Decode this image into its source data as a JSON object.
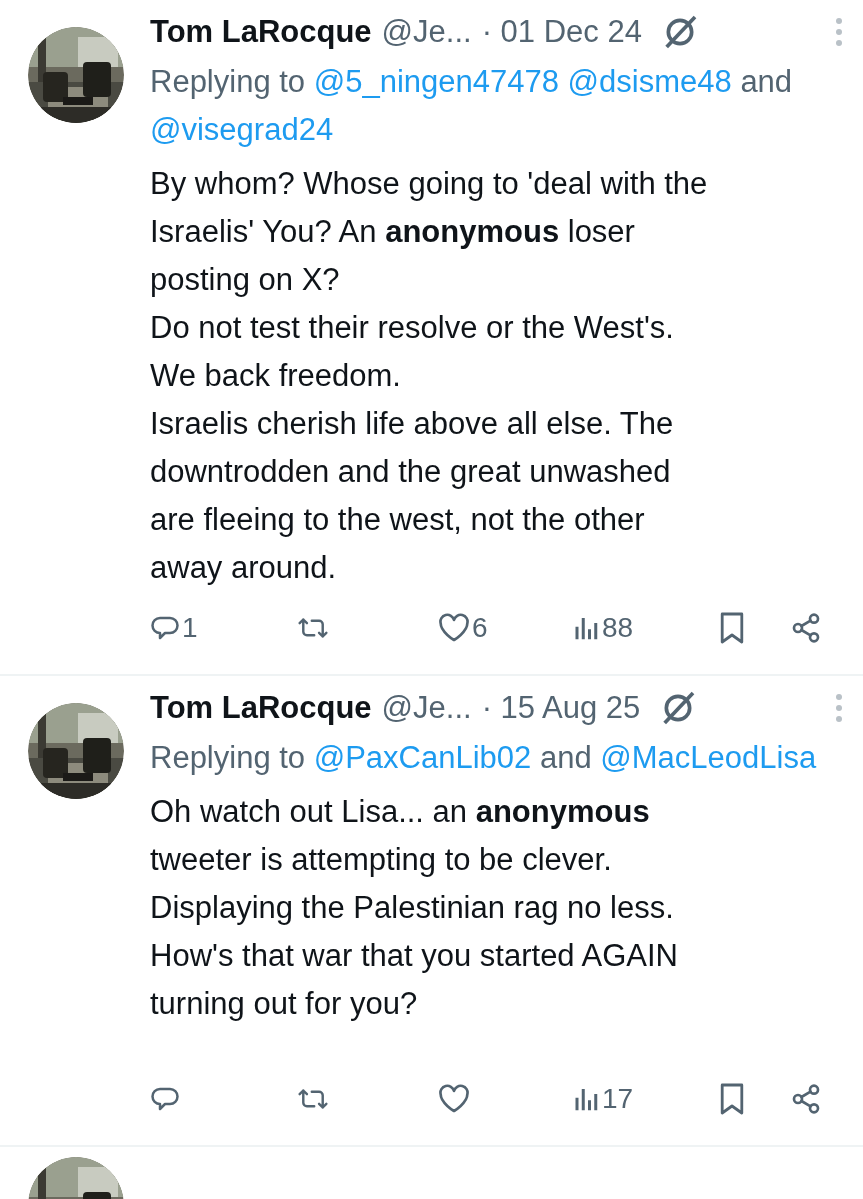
{
  "tweets": [
    {
      "name": "Tom LaRocque",
      "handle": "@Je...",
      "date": "· 01 Dec 24",
      "replying_to": [
        {
          "kind": "plain",
          "text": "Replying to"
        },
        {
          "kind": "mention",
          "text": "@5_ningen47478"
        },
        {
          "kind": "mention",
          "text": "@dsisme48"
        },
        {
          "kind": "plain",
          "text": "and"
        },
        {
          "kind": "mention",
          "text": "@visegrad24"
        }
      ],
      "lines": [
        "By whom? Whose going to 'deal with the",
        "Israelis'  You? An **anonymous** loser",
        "posting on X?",
        "Do not test their resolve or the West's.",
        "We back freedom.",
        "Israelis cherish life above all else. The",
        "downtrodden and the great unwashed",
        "are fleeing to the west, not the other",
        "away around."
      ],
      "actions": {
        "replies": "1",
        "likes": "6",
        "views": "88"
      }
    },
    {
      "name": "Tom LaRocque",
      "handle": "@Je...",
      "date": "· 15 Aug 25",
      "replying_to": [
        {
          "kind": "plain",
          "text": "Replying to"
        },
        {
          "kind": "mention",
          "text": "@PaxCanLib02"
        },
        {
          "kind": "plain",
          "text": "and"
        },
        {
          "kind": "mention",
          "text": "@MacLeodLisa"
        }
      ],
      "lines": [
        "Oh watch out Lisa... an **anonymous**",
        "tweeter is attempting to be clever.",
        "Displaying the Palestinian rag no less.",
        "How's that war that you started AGAIN",
        "turning out for you?"
      ],
      "actions": {
        "views": "17"
      }
    }
  ]
}
